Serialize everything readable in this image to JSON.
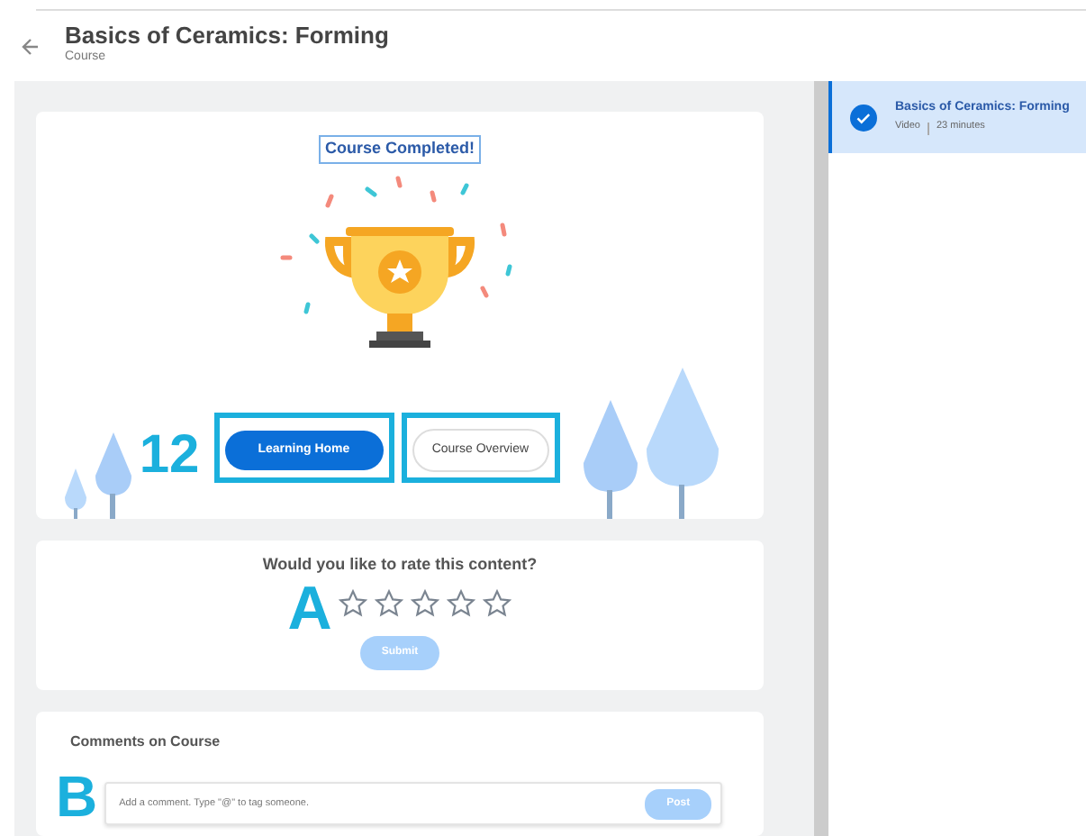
{
  "header": {
    "title": "Basics of Ceramics: Forming",
    "subtitle": "Course"
  },
  "completion": {
    "title": "Course Completed!",
    "callout": "12",
    "buttons": [
      {
        "label": "Learning Home",
        "kind": "primary",
        "highlighted": true
      },
      {
        "label": "Course Overview",
        "kind": "secondary",
        "highlighted": true
      }
    ]
  },
  "rating": {
    "question": "Would you like to rate this content?",
    "callout": "A",
    "stars": 0,
    "submit": {
      "label": "Submit",
      "disabled": true
    }
  },
  "comments": {
    "title": "Comments on Course",
    "callout": "B",
    "placeholder": "Add a comment. Type \"@\" to tag someone.",
    "post": {
      "label": "Post",
      "disabled": true
    }
  },
  "sidebar": {
    "items": [
      {
        "title": "Basics of Ceramics: Forming",
        "type": "Video",
        "duration": "23 minutes",
        "selected": true,
        "completed": true
      }
    ]
  }
}
